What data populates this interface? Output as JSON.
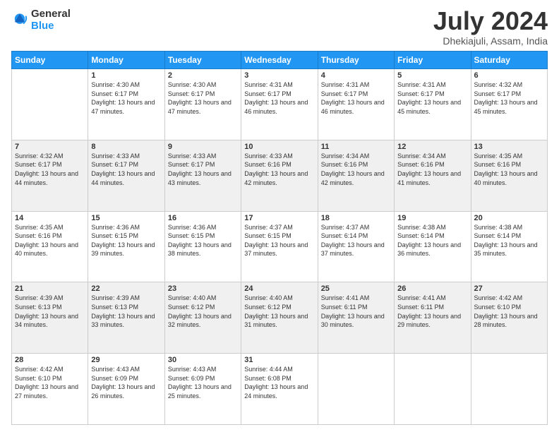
{
  "logo": {
    "line1": "General",
    "line2": "Blue",
    "icon_color": "#2196F3"
  },
  "header": {
    "month_year": "July 2024",
    "location": "Dhekiajuli, Assam, India"
  },
  "weekdays": [
    "Sunday",
    "Monday",
    "Tuesday",
    "Wednesday",
    "Thursday",
    "Friday",
    "Saturday"
  ],
  "weeks": [
    [
      {
        "day": "",
        "sunrise": "",
        "sunset": "",
        "daylight": ""
      },
      {
        "day": "1",
        "sunrise": "Sunrise: 4:30 AM",
        "sunset": "Sunset: 6:17 PM",
        "daylight": "Daylight: 13 hours and 47 minutes."
      },
      {
        "day": "2",
        "sunrise": "Sunrise: 4:30 AM",
        "sunset": "Sunset: 6:17 PM",
        "daylight": "Daylight: 13 hours and 47 minutes."
      },
      {
        "day": "3",
        "sunrise": "Sunrise: 4:31 AM",
        "sunset": "Sunset: 6:17 PM",
        "daylight": "Daylight: 13 hours and 46 minutes."
      },
      {
        "day": "4",
        "sunrise": "Sunrise: 4:31 AM",
        "sunset": "Sunset: 6:17 PM",
        "daylight": "Daylight: 13 hours and 46 minutes."
      },
      {
        "day": "5",
        "sunrise": "Sunrise: 4:31 AM",
        "sunset": "Sunset: 6:17 PM",
        "daylight": "Daylight: 13 hours and 45 minutes."
      },
      {
        "day": "6",
        "sunrise": "Sunrise: 4:32 AM",
        "sunset": "Sunset: 6:17 PM",
        "daylight": "Daylight: 13 hours and 45 minutes."
      }
    ],
    [
      {
        "day": "7",
        "sunrise": "Sunrise: 4:32 AM",
        "sunset": "Sunset: 6:17 PM",
        "daylight": "Daylight: 13 hours and 44 minutes."
      },
      {
        "day": "8",
        "sunrise": "Sunrise: 4:33 AM",
        "sunset": "Sunset: 6:17 PM",
        "daylight": "Daylight: 13 hours and 44 minutes."
      },
      {
        "day": "9",
        "sunrise": "Sunrise: 4:33 AM",
        "sunset": "Sunset: 6:17 PM",
        "daylight": "Daylight: 13 hours and 43 minutes."
      },
      {
        "day": "10",
        "sunrise": "Sunrise: 4:33 AM",
        "sunset": "Sunset: 6:16 PM",
        "daylight": "Daylight: 13 hours and 42 minutes."
      },
      {
        "day": "11",
        "sunrise": "Sunrise: 4:34 AM",
        "sunset": "Sunset: 6:16 PM",
        "daylight": "Daylight: 13 hours and 42 minutes."
      },
      {
        "day": "12",
        "sunrise": "Sunrise: 4:34 AM",
        "sunset": "Sunset: 6:16 PM",
        "daylight": "Daylight: 13 hours and 41 minutes."
      },
      {
        "day": "13",
        "sunrise": "Sunrise: 4:35 AM",
        "sunset": "Sunset: 6:16 PM",
        "daylight": "Daylight: 13 hours and 40 minutes."
      }
    ],
    [
      {
        "day": "14",
        "sunrise": "Sunrise: 4:35 AM",
        "sunset": "Sunset: 6:16 PM",
        "daylight": "Daylight: 13 hours and 40 minutes."
      },
      {
        "day": "15",
        "sunrise": "Sunrise: 4:36 AM",
        "sunset": "Sunset: 6:15 PM",
        "daylight": "Daylight: 13 hours and 39 minutes."
      },
      {
        "day": "16",
        "sunrise": "Sunrise: 4:36 AM",
        "sunset": "Sunset: 6:15 PM",
        "daylight": "Daylight: 13 hours and 38 minutes."
      },
      {
        "day": "17",
        "sunrise": "Sunrise: 4:37 AM",
        "sunset": "Sunset: 6:15 PM",
        "daylight": "Daylight: 13 hours and 37 minutes."
      },
      {
        "day": "18",
        "sunrise": "Sunrise: 4:37 AM",
        "sunset": "Sunset: 6:14 PM",
        "daylight": "Daylight: 13 hours and 37 minutes."
      },
      {
        "day": "19",
        "sunrise": "Sunrise: 4:38 AM",
        "sunset": "Sunset: 6:14 PM",
        "daylight": "Daylight: 13 hours and 36 minutes."
      },
      {
        "day": "20",
        "sunrise": "Sunrise: 4:38 AM",
        "sunset": "Sunset: 6:14 PM",
        "daylight": "Daylight: 13 hours and 35 minutes."
      }
    ],
    [
      {
        "day": "21",
        "sunrise": "Sunrise: 4:39 AM",
        "sunset": "Sunset: 6:13 PM",
        "daylight": "Daylight: 13 hours and 34 minutes."
      },
      {
        "day": "22",
        "sunrise": "Sunrise: 4:39 AM",
        "sunset": "Sunset: 6:13 PM",
        "daylight": "Daylight: 13 hours and 33 minutes."
      },
      {
        "day": "23",
        "sunrise": "Sunrise: 4:40 AM",
        "sunset": "Sunset: 6:12 PM",
        "daylight": "Daylight: 13 hours and 32 minutes."
      },
      {
        "day": "24",
        "sunrise": "Sunrise: 4:40 AM",
        "sunset": "Sunset: 6:12 PM",
        "daylight": "Daylight: 13 hours and 31 minutes."
      },
      {
        "day": "25",
        "sunrise": "Sunrise: 4:41 AM",
        "sunset": "Sunset: 6:11 PM",
        "daylight": "Daylight: 13 hours and 30 minutes."
      },
      {
        "day": "26",
        "sunrise": "Sunrise: 4:41 AM",
        "sunset": "Sunset: 6:11 PM",
        "daylight": "Daylight: 13 hours and 29 minutes."
      },
      {
        "day": "27",
        "sunrise": "Sunrise: 4:42 AM",
        "sunset": "Sunset: 6:10 PM",
        "daylight": "Daylight: 13 hours and 28 minutes."
      }
    ],
    [
      {
        "day": "28",
        "sunrise": "Sunrise: 4:42 AM",
        "sunset": "Sunset: 6:10 PM",
        "daylight": "Daylight: 13 hours and 27 minutes."
      },
      {
        "day": "29",
        "sunrise": "Sunrise: 4:43 AM",
        "sunset": "Sunset: 6:09 PM",
        "daylight": "Daylight: 13 hours and 26 minutes."
      },
      {
        "day": "30",
        "sunrise": "Sunrise: 4:43 AM",
        "sunset": "Sunset: 6:09 PM",
        "daylight": "Daylight: 13 hours and 25 minutes."
      },
      {
        "day": "31",
        "sunrise": "Sunrise: 4:44 AM",
        "sunset": "Sunset: 6:08 PM",
        "daylight": "Daylight: 13 hours and 24 minutes."
      },
      {
        "day": "",
        "sunrise": "",
        "sunset": "",
        "daylight": ""
      },
      {
        "day": "",
        "sunrise": "",
        "sunset": "",
        "daylight": ""
      },
      {
        "day": "",
        "sunrise": "",
        "sunset": "",
        "daylight": ""
      }
    ]
  ]
}
